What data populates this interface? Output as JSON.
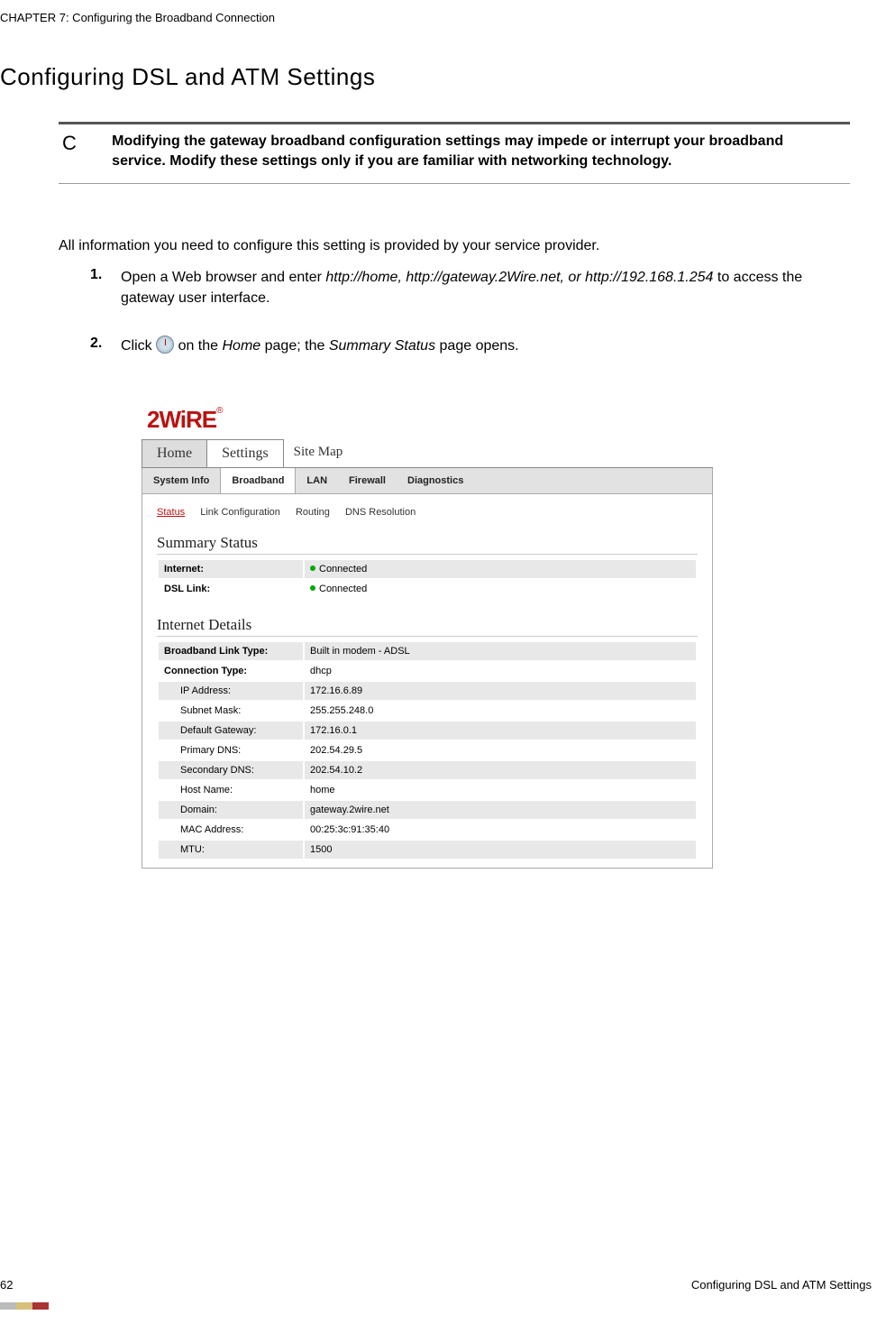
{
  "chapter_header": "CHAPTER 7: Configuring the Broadband Connection",
  "section_title": "Configuring DSL and ATM Settings",
  "caution_letter": "C",
  "caution_text": "Modifying the gateway broadband configuration settings may impede or interrupt your broadband service. Modify these settings only if you are familiar with networking technology.",
  "intro": "All information you need to configure this setting is provided by your service provider.",
  "steps": {
    "s1_num": "1.",
    "s1_a": "Open a Web browser and enter ",
    "s1_i": "http://home, http://gateway.2Wire.net, or http://192.168.1.254",
    "s1_b": " to access the gateway user interface.",
    "s2_num": "2.",
    "s2_a": "Click ",
    "s2_b": " on the ",
    "s2_home": "Home",
    "s2_c": " page; the ",
    "s2_ss": "Summary Status",
    "s2_d": " page opens."
  },
  "screenshot": {
    "logo_text": "2WiRE",
    "reg": "®",
    "tabs": {
      "home": "Home",
      "settings": "Settings",
      "sitemap": "Site Map"
    },
    "subtabs": {
      "sysinfo": "System Info",
      "broadband": "Broadband",
      "lan": "LAN",
      "firewall": "Firewall",
      "diag": "Diagnostics"
    },
    "tertiary": {
      "status": "Status",
      "linkcfg": "Link Configuration",
      "routing": "Routing",
      "dns": "DNS Resolution"
    },
    "summary_h": "Summary Status",
    "summary": {
      "internet_l": "Internet:",
      "internet_v": "Connected",
      "dsl_l": "DSL Link:",
      "dsl_v": "Connected"
    },
    "details_h": "Internet Details",
    "details": {
      "blt_l": "Broadband Link Type:",
      "blt_v": "Built in modem - ADSL",
      "ct_l": "Connection Type:",
      "ct_v": "dhcp",
      "ip_l": "IP Address:",
      "ip_v": "172.16.6.89",
      "sm_l": "Subnet Mask:",
      "sm_v": "255.255.248.0",
      "dg_l": "Default Gateway:",
      "dg_v": "172.16.0.1",
      "pdns_l": "Primary DNS:",
      "pdns_v": "202.54.29.5",
      "sdns_l": "Secondary DNS:",
      "sdns_v": "202.54.10.2",
      "hn_l": "Host Name:",
      "hn_v": "home",
      "dom_l": "Domain:",
      "dom_v": "gateway.2wire.net",
      "mac_l": "MAC Address:",
      "mac_v": "00:25:3c:91:35:40",
      "mtu_l": "MTU:",
      "mtu_v": "1500"
    }
  },
  "footer": {
    "page": "62",
    "title": "Configuring DSL and ATM Settings"
  }
}
